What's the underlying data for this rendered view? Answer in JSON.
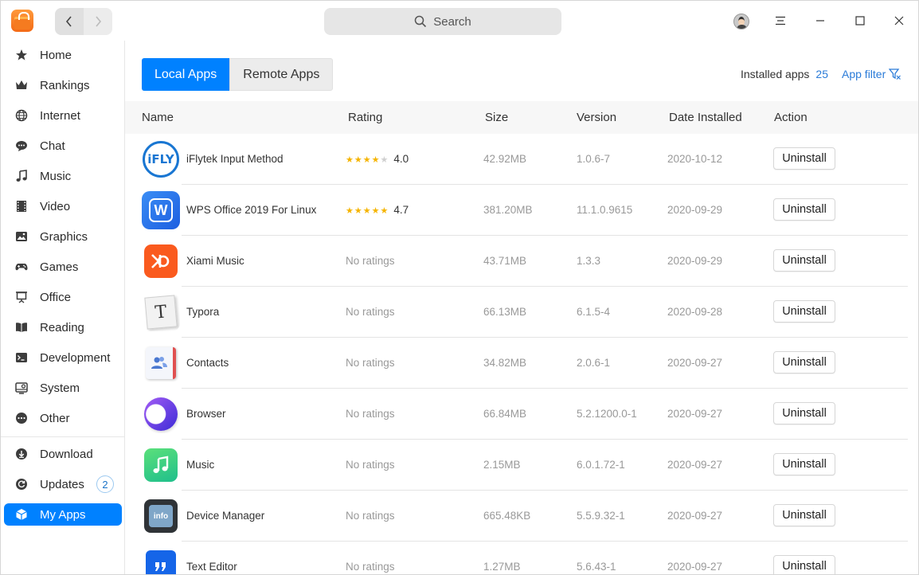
{
  "titlebar": {
    "search_label": "Search"
  },
  "sidebar": {
    "items": [
      {
        "label": "Home",
        "icon": "star-icon"
      },
      {
        "label": "Rankings",
        "icon": "crown-icon"
      },
      {
        "label": "Internet",
        "icon": "globe-icon"
      },
      {
        "label": "Chat",
        "icon": "chat-icon"
      },
      {
        "label": "Music",
        "icon": "music-note-icon"
      },
      {
        "label": "Video",
        "icon": "film-icon"
      },
      {
        "label": "Graphics",
        "icon": "image-icon"
      },
      {
        "label": "Games",
        "icon": "gamepad-icon"
      },
      {
        "label": "Office",
        "icon": "presentation-icon"
      },
      {
        "label": "Reading",
        "icon": "book-icon"
      },
      {
        "label": "Development",
        "icon": "terminal-icon"
      },
      {
        "label": "System",
        "icon": "system-icon"
      },
      {
        "label": "Other",
        "icon": "more-icon"
      }
    ],
    "bottom_items": [
      {
        "label": "Download",
        "icon": "download-icon"
      },
      {
        "label": "Updates",
        "icon": "refresh-icon",
        "badge": "2"
      },
      {
        "label": "My Apps",
        "icon": "cube-icon",
        "active": true
      }
    ]
  },
  "main": {
    "tabs": [
      {
        "label": "Local Apps",
        "active": true
      },
      {
        "label": "Remote Apps",
        "active": false
      }
    ],
    "installed_label": "Installed apps",
    "installed_count": "25",
    "filter_label": "App filter",
    "columns": {
      "name": "Name",
      "rating": "Rating",
      "size": "Size",
      "version": "Version",
      "date": "Date Installed",
      "action": "Action"
    },
    "action_label": "Uninstall",
    "apps": [
      {
        "name": "iFlytek Input Method",
        "rating": "4.0",
        "stars": 4,
        "size": "42.92MB",
        "version": "1.0.6-7",
        "date": "2020-10-12",
        "icon": "iflytek-icon",
        "icon_text": "iFLY"
      },
      {
        "name": "WPS Office 2019 For Linux",
        "rating": "4.7",
        "stars": 5,
        "size": "381.20MB",
        "version": "11.1.0.9615",
        "date": "2020-09-29",
        "icon": "wps-office-icon",
        "icon_text": "W"
      },
      {
        "name": "Xiami Music",
        "rating": "No ratings",
        "size": "43.71MB",
        "version": "1.3.3",
        "date": "2020-09-29",
        "icon": "xiami-music-icon"
      },
      {
        "name": "Typora",
        "rating": "No ratings",
        "size": "66.13MB",
        "version": "6.1.5-4",
        "date": "2020-09-28",
        "icon": "typora-icon",
        "icon_text": "T"
      },
      {
        "name": "Contacts",
        "rating": "No ratings",
        "size": "34.82MB",
        "version": "2.0.6-1",
        "date": "2020-09-27",
        "icon": "contacts-icon"
      },
      {
        "name": "Browser",
        "rating": "No ratings",
        "size": "66.84MB",
        "version": "5.2.1200.0-1",
        "date": "2020-09-27",
        "icon": "browser-icon"
      },
      {
        "name": "Music",
        "rating": "No ratings",
        "size": "2.15MB",
        "version": "6.0.1.72-1",
        "date": "2020-09-27",
        "icon": "music-app-icon"
      },
      {
        "name": "Device Manager",
        "rating": "No ratings",
        "size": "665.48KB",
        "version": "5.5.9.32-1",
        "date": "2020-09-27",
        "icon": "device-manager-icon",
        "icon_text": "info"
      },
      {
        "name": "Text Editor",
        "rating": "No ratings",
        "size": "1.27MB",
        "version": "5.6.43-1",
        "date": "2020-09-27",
        "icon": "text-editor-icon"
      }
    ]
  },
  "colors": {
    "accent": "#0081ff",
    "link": "#2a7bd8",
    "star": "#f5b400"
  }
}
